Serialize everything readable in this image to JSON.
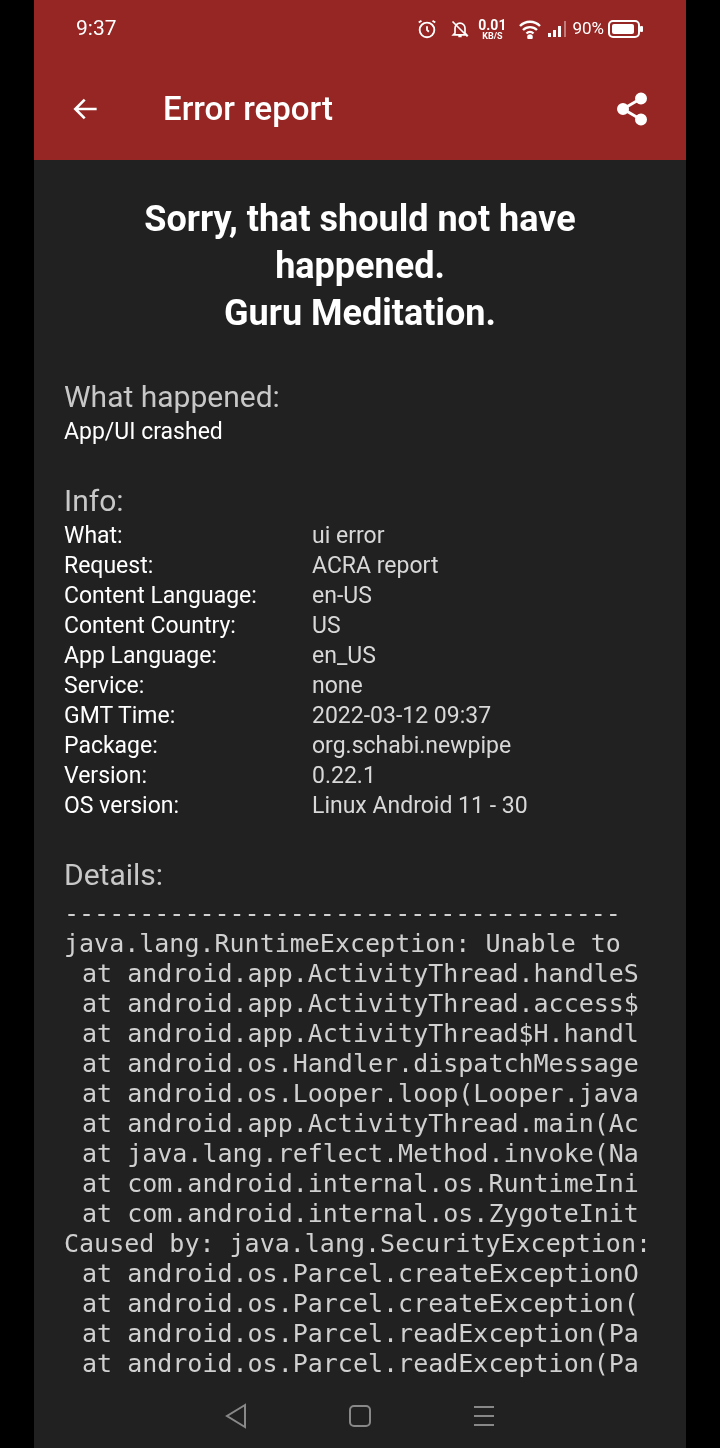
{
  "status_bar": {
    "time": "9:37",
    "net_speed": "0.01",
    "net_unit": "KB/S",
    "battery": "90%"
  },
  "app_bar": {
    "title": "Error report"
  },
  "headline": [
    "Sorry, that should not have happened.",
    "Guru Meditation."
  ],
  "what_happened": {
    "heading": "What happened:",
    "text": "App/UI crashed"
  },
  "info": {
    "heading": "Info:",
    "rows": [
      {
        "label": "What:",
        "value": "ui error"
      },
      {
        "label": "Request:",
        "value": "ACRA report"
      },
      {
        "label": "Content Language:",
        "value": "en-US"
      },
      {
        "label": "Content Country:",
        "value": "US"
      },
      {
        "label": "App Language:",
        "value": "en_US"
      },
      {
        "label": "Service:",
        "value": "none"
      },
      {
        "label": "GMT Time:",
        "value": "2022-03-12 09:37"
      },
      {
        "label": "Package:",
        "value": "org.schabi.newpipe"
      },
      {
        "label": "Version:",
        "value": "0.22.1"
      },
      {
        "label": "OS version:",
        "value": "Linux Android 11 - 30"
      }
    ]
  },
  "details": {
    "heading": "Details:",
    "lines": [
      {
        "kind": "plain",
        "text": "-------------------------------------"
      },
      {
        "kind": "plain",
        "text": "java.lang.RuntimeException: Unable to"
      },
      {
        "kind": "frame",
        "text": "at android.app.ActivityThread.handleS"
      },
      {
        "kind": "frame",
        "text": "at android.app.ActivityThread.access$"
      },
      {
        "kind": "frame",
        "text": "at android.app.ActivityThread$H.handl"
      },
      {
        "kind": "frame",
        "text": "at android.os.Handler.dispatchMessage"
      },
      {
        "kind": "frame",
        "text": "at android.os.Looper.loop(Looper.java"
      },
      {
        "kind": "frame",
        "text": "at android.app.ActivityThread.main(Ac"
      },
      {
        "kind": "frame",
        "text": "at java.lang.reflect.Method.invoke(Na"
      },
      {
        "kind": "frame",
        "text": "at com.android.internal.os.RuntimeIni"
      },
      {
        "kind": "frame",
        "text": "at com.android.internal.os.ZygoteInit"
      },
      {
        "kind": "plain",
        "text": "Caused by: java.lang.SecurityException:"
      },
      {
        "kind": "frame",
        "text": "at android.os.Parcel.createExceptionO"
      },
      {
        "kind": "frame",
        "text": "at android.os.Parcel.createException("
      },
      {
        "kind": "frame",
        "text": "at android.os.Parcel.readException(Pa"
      },
      {
        "kind": "frame",
        "text": "at android.os.Parcel.readException(Pa"
      }
    ]
  }
}
